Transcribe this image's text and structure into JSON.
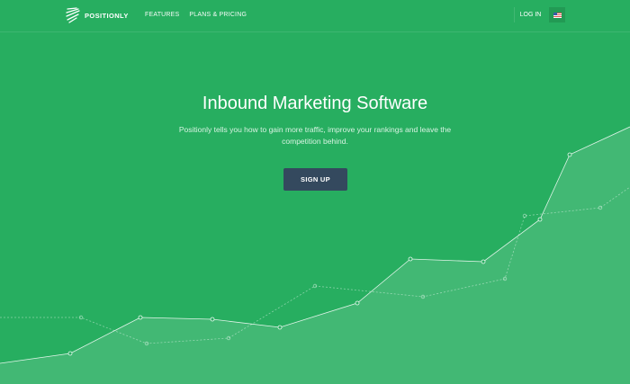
{
  "header": {
    "logo_text": "POSITIONLY",
    "logo_icon": "positionly-logo-icon",
    "nav": [
      {
        "label": "FEATURES"
      },
      {
        "label": "PLANS & PRICING"
      }
    ],
    "login_label": "LOG IN",
    "language_icon": "us-flag-icon"
  },
  "hero": {
    "title": "Inbound Marketing Software",
    "subtitle": "Positionly tells you how to gain more traffic, improve your rankings and leave the competition behind.",
    "cta_label": "SIGN UP"
  },
  "colors": {
    "background": "#27ae60",
    "button": "#34495e",
    "text": "#ffffff"
  }
}
